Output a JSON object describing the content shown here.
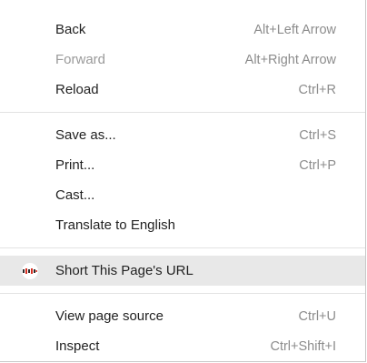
{
  "menu": {
    "groups": [
      [
        {
          "label": "Back",
          "shortcut": "Alt+Left Arrow",
          "disabled": false
        },
        {
          "label": "Forward",
          "shortcut": "Alt+Right Arrow",
          "disabled": true
        },
        {
          "label": "Reload",
          "shortcut": "Ctrl+R",
          "disabled": false
        }
      ],
      [
        {
          "label": "Save as...",
          "shortcut": "Ctrl+S",
          "disabled": false
        },
        {
          "label": "Print...",
          "shortcut": "Ctrl+P",
          "disabled": false
        },
        {
          "label": "Cast...",
          "shortcut": "",
          "disabled": false
        },
        {
          "label": "Translate to English",
          "shortcut": "",
          "disabled": false
        }
      ],
      [
        {
          "label": "Short This Page's URL",
          "shortcut": "",
          "disabled": false,
          "icon": "link-shortener-extension-icon"
        }
      ],
      [
        {
          "label": "View page source",
          "shortcut": "Ctrl+U",
          "disabled": false
        },
        {
          "label": "Inspect",
          "shortcut": "Ctrl+Shift+I",
          "disabled": false
        }
      ]
    ]
  },
  "colors": {
    "text": "#222222",
    "disabled_text": "#9a9a9a",
    "shortcut_text": "#8c8c8c",
    "highlight": "#e8e8e8",
    "icon_red": "#d62d20",
    "icon_dark": "#2b2b2b"
  }
}
